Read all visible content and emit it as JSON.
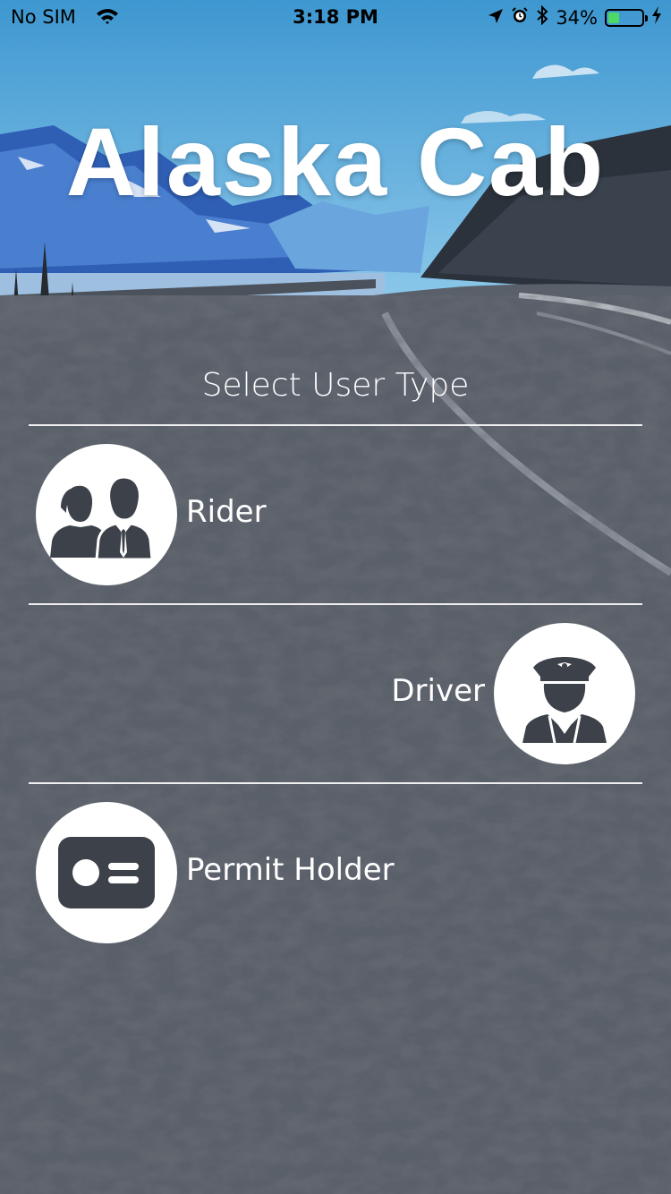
{
  "status_bar": {
    "carrier": "No SIM",
    "time": "3:18 PM",
    "battery_percent": "34%",
    "battery_level": 0.34,
    "icons": [
      "wifi-icon",
      "location-arrow-icon",
      "alarm-icon",
      "bluetooth-icon",
      "battery-icon",
      "charging-icon"
    ]
  },
  "app": {
    "title": "Alaska Cab",
    "subtitle": "Select User Type"
  },
  "user_types": [
    {
      "label": "Rider",
      "icon": "rider-people-icon"
    },
    {
      "label": "Driver",
      "icon": "driver-chauffeur-icon"
    },
    {
      "label": "Permit Holder",
      "icon": "permit-card-icon"
    }
  ],
  "colors": {
    "text": "#ffffff",
    "icon_circle": "#ffffff",
    "icon_glyph": "#3d424a",
    "battery_fill": "#4cd964"
  }
}
